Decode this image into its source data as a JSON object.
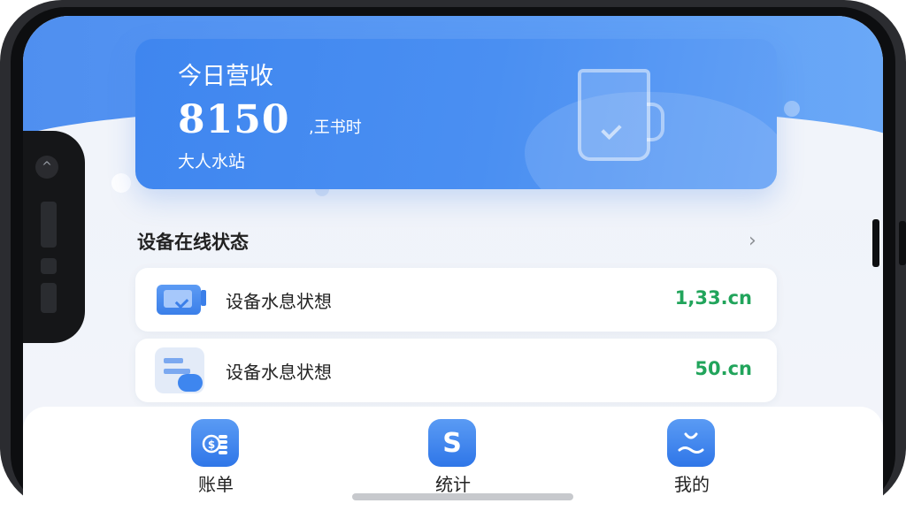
{
  "revenue_card": {
    "title": "今日营收",
    "amount": "8150",
    "unit": ",王书时",
    "station": "大人水站"
  },
  "device_status": {
    "title": "设备在线状态",
    "rows": [
      {
        "label": "设备水息状想",
        "value": "1,33.cn",
        "icon": "monitor-check-icon"
      },
      {
        "label": "设备水息状想",
        "value": "50.cn",
        "icon": "control-panel-icon"
      }
    ],
    "value_color": "#21a45b"
  },
  "tabbar": {
    "tabs": [
      {
        "label": "账单",
        "icon": "coin-stack-icon"
      },
      {
        "label": "统计",
        "icon": "s-logo-icon",
        "glyph": "S"
      },
      {
        "label": "我的",
        "icon": "profile-bag-icon"
      }
    ]
  },
  "colors": {
    "accent": "#3f86ef",
    "background": "#eef2f9"
  }
}
